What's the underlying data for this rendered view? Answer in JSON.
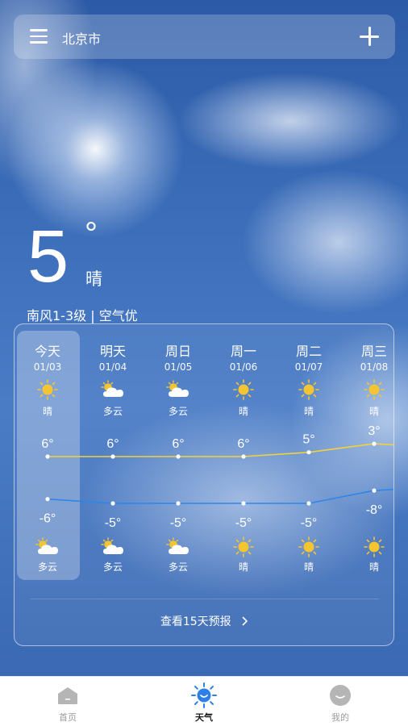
{
  "header": {
    "city": "北京市",
    "menu_icon": "menu-icon",
    "add_icon": "plus-icon"
  },
  "current": {
    "temperature": "5",
    "degree_symbol": "°",
    "condition": "晴",
    "wind_air": "南风1-3级 | 空气优"
  },
  "forecast": {
    "days": [
      {
        "name": "今天",
        "date": "01/03",
        "day_desc": "晴",
        "day_icon": "sun-icon",
        "high": "6°",
        "high_value": 6,
        "low": "-6°",
        "low_value": -6,
        "night_icon": "partly-cloudy-icon",
        "night_desc": "多云"
      },
      {
        "name": "明天",
        "date": "01/04",
        "day_desc": "多云",
        "day_icon": "partly-cloudy-icon",
        "high": "6°",
        "high_value": 6,
        "low": "-5°",
        "low_value": -5,
        "night_icon": "partly-cloudy-icon",
        "night_desc": "多云"
      },
      {
        "name": "周日",
        "date": "01/05",
        "day_desc": "多云",
        "day_icon": "partly-cloudy-icon",
        "high": "6°",
        "high_value": 6,
        "low": "-5°",
        "low_value": -5,
        "night_icon": "partly-cloudy-icon",
        "night_desc": "多云"
      },
      {
        "name": "周一",
        "date": "01/06",
        "day_desc": "晴",
        "day_icon": "sun-icon",
        "high": "6°",
        "high_value": 6,
        "low": "-5°",
        "low_value": -5,
        "night_icon": "sun-icon",
        "night_desc": "晴"
      },
      {
        "name": "周二",
        "date": "01/07",
        "day_desc": "晴",
        "day_icon": "sun-icon",
        "high": "5°",
        "high_value": 5,
        "low": "-5°",
        "low_value": -5,
        "night_icon": "sun-icon",
        "night_desc": "晴"
      },
      {
        "name": "周三",
        "date": "01/08",
        "day_desc": "晴",
        "day_icon": "sun-icon",
        "high": "3°",
        "high_value": 3,
        "low": "-8°",
        "low_value": -8,
        "night_icon": "sun-icon",
        "night_desc": "晴"
      }
    ],
    "more_label": "查看15天预报",
    "more_icon": "chevron-right-icon"
  },
  "colors": {
    "high_line": "#f2d23a",
    "low_line": "#2f86e8",
    "sun": "#f5c531"
  },
  "nav": {
    "items": [
      {
        "label": "首页",
        "icon": "home-icon",
        "active": false
      },
      {
        "label": "天气",
        "icon": "weather-icon",
        "active": true
      },
      {
        "label": "我的",
        "icon": "profile-icon",
        "active": false
      }
    ]
  }
}
